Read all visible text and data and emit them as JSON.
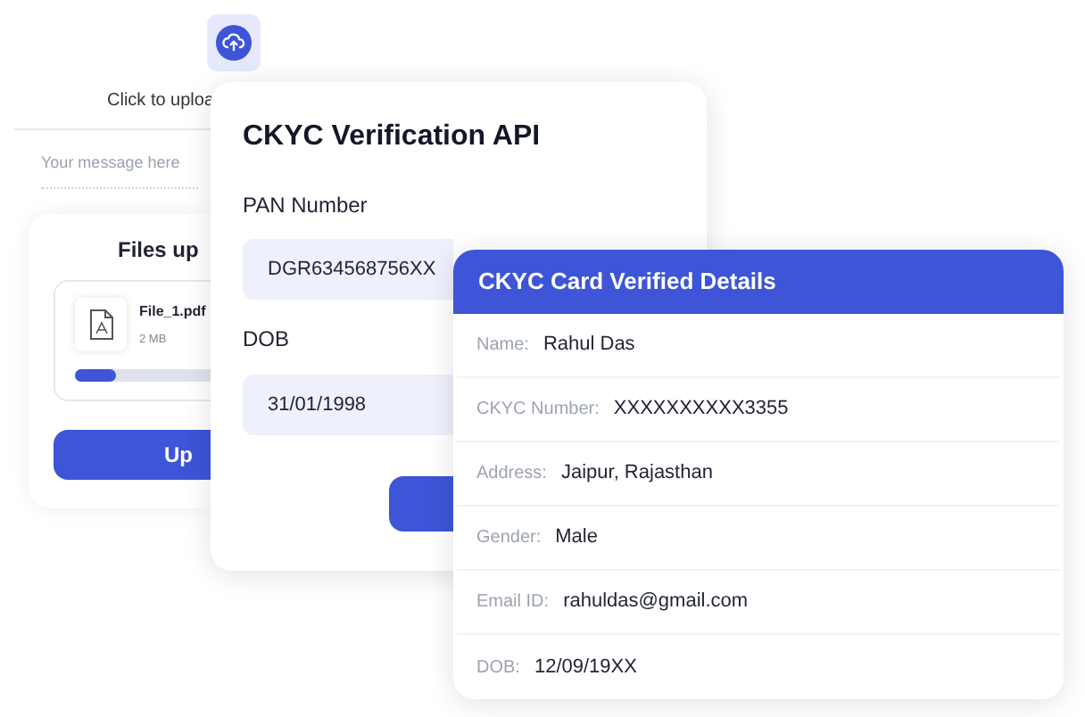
{
  "uploader": {
    "prompt": "Click to uploa",
    "message_placeholder": "Your message here",
    "files_title": "Files up",
    "file": {
      "name": "File_1.pdf",
      "size": "2 MB",
      "level": 0.3
    },
    "button": "Up"
  },
  "verification": {
    "title": "CKYC Verification API",
    "fields": [
      {
        "label": "PAN Number",
        "value": "DGR634568756XX"
      },
      {
        "label": "DOB",
        "value": "31/01/1998"
      }
    ]
  },
  "details": {
    "title": "CKYC Card Verified Details",
    "rows": [
      {
        "label": "Name:",
        "value": "Rahul Das"
      },
      {
        "label": "CKYC Number:",
        "value": "XXXXXXXXXX3355"
      },
      {
        "label": "Address:",
        "value": "Jaipur, Rajasthan"
      },
      {
        "label": "Gender:",
        "value": "Male"
      },
      {
        "label": "Email ID:",
        "value": "rahuldas@gmail.com"
      },
      {
        "label": "DOB:",
        "value": "12/09/19XX"
      }
    ]
  }
}
